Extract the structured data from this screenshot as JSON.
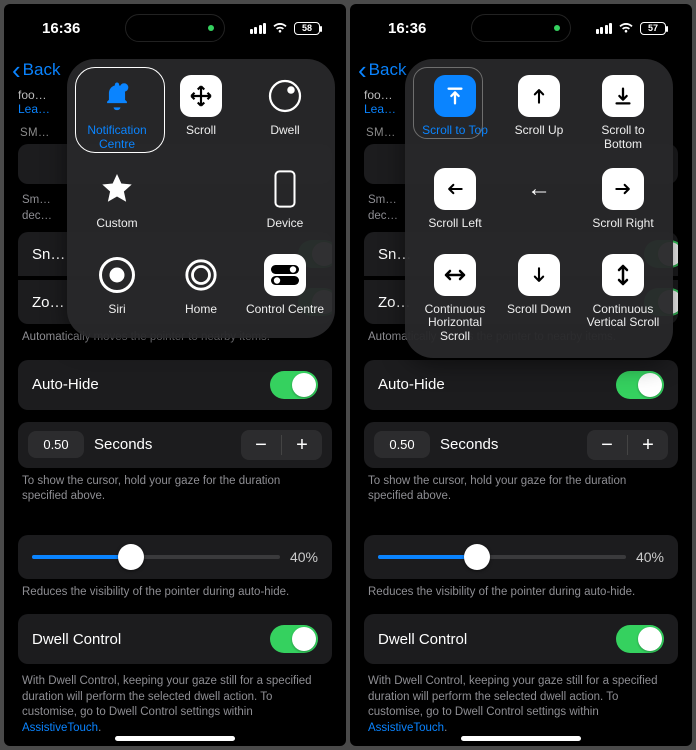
{
  "status": {
    "time": "16:36",
    "battery_left": "58",
    "battery_right": "57"
  },
  "nav": {
    "back": "Back"
  },
  "cutTop": {
    "line": "foo…",
    "learn": "Lea…",
    "sm_label": "SM…",
    "sm_desc1": "Sm…",
    "sm_desc2": "dec…",
    "sn": "Sn…",
    "zo": "Zo…",
    "auto_move_note": "Automatically moves the pointer to nearby items."
  },
  "autoHide": {
    "label": "Auto-Hide"
  },
  "duration": {
    "value": "0.50",
    "unit": "Seconds",
    "note": "To show the cursor, hold your gaze for the duration specified above."
  },
  "slider": {
    "percent": "40%",
    "note": "Reduces the visibility of the pointer during auto-hide."
  },
  "dwell": {
    "label": "Dwell Control",
    "note_a": "With Dwell Control, keeping your gaze still for a specified duration will perform the selected dwell action. To customise, go to Dwell Control settings within ",
    "link": "AssistiveTouch",
    "note_b": "."
  },
  "overlayLeft": {
    "items": [
      "Notification Centre",
      "Scroll",
      "Dwell",
      "Custom",
      "",
      "Device",
      "Siri",
      "Home",
      "Control Centre"
    ]
  },
  "overlayRight": {
    "items": [
      "Scroll to Top",
      "Scroll Up",
      "Scroll to Bottom",
      "Scroll Left",
      "",
      "Scroll Right",
      "Continuous Horizontal Scroll",
      "Scroll Down",
      "Continuous Vertical Scroll"
    ]
  }
}
